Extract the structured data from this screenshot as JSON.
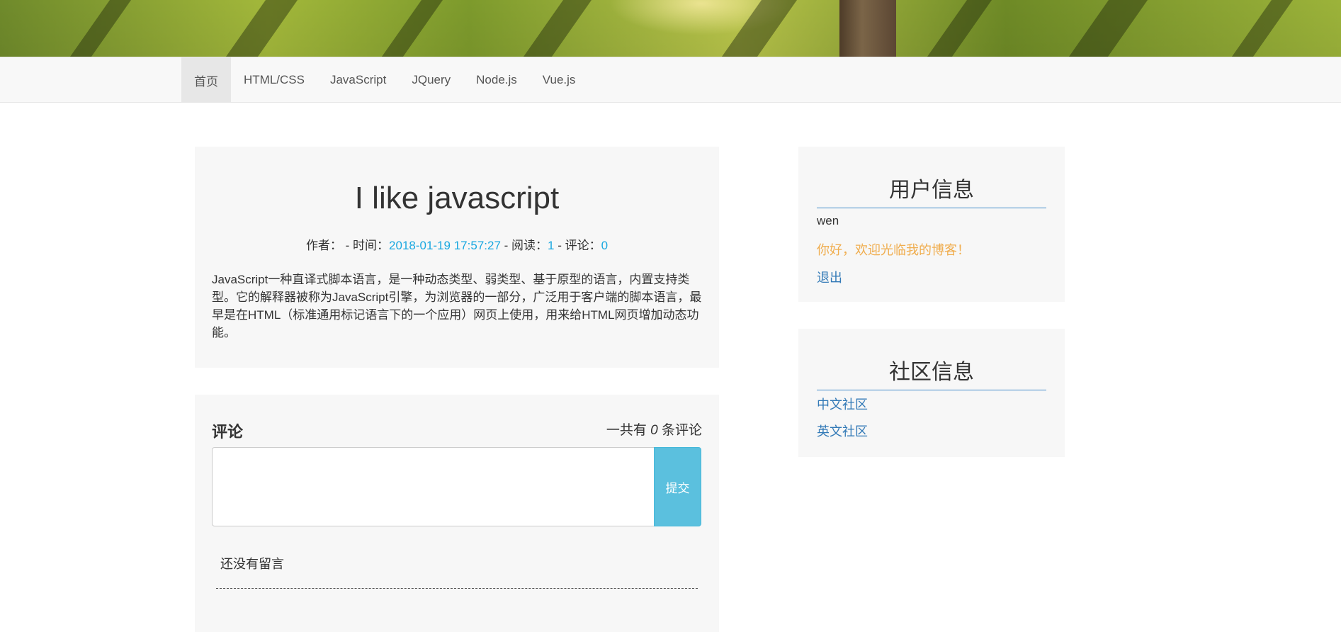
{
  "nav": {
    "items": [
      {
        "label": "首页",
        "active": true
      },
      {
        "label": "HTML/CSS"
      },
      {
        "label": "JavaScript"
      },
      {
        "label": "JQuery"
      },
      {
        "label": "Node.js"
      },
      {
        "label": "Vue.js"
      }
    ]
  },
  "article": {
    "title": "I like javascript",
    "meta": {
      "author_label": "作者：",
      "sep1": " - 时间：",
      "time": "2018-01-19 17:57:27",
      "sep2": " - 阅读：",
      "reads": "1",
      "sep3": " - 评论：",
      "comments": "0"
    },
    "body": "JavaScript一种直译式脚本语言，是一种动态类型、弱类型、基于原型的语言，内置支持类型。它的解释器被称为JavaScript引擎，为浏览器的一部分，广泛用于客户端的脚本语言，最早是在HTML（标准通用标记语言下的一个应用）网页上使用，用来给HTML网页增加动态功能。"
  },
  "comments": {
    "title": "评论",
    "count_prefix": "一共有 ",
    "count": "0",
    "count_suffix": " 条评论",
    "textarea_value": "",
    "submit_label": "提交",
    "empty_text": "还没有留言"
  },
  "user_panel": {
    "title": "用户信息",
    "username": "wen",
    "welcome": "你好，欢迎光临我的博客！",
    "logout": "退出"
  },
  "community_panel": {
    "title": "社区信息",
    "links": [
      "中文社区",
      "英文社区"
    ]
  },
  "colors": {
    "accent_link": "#337ab7",
    "meta_highlight": "#1aa8e0",
    "welcome": "#f0ad4e",
    "submit_button": "#5bc0de"
  }
}
